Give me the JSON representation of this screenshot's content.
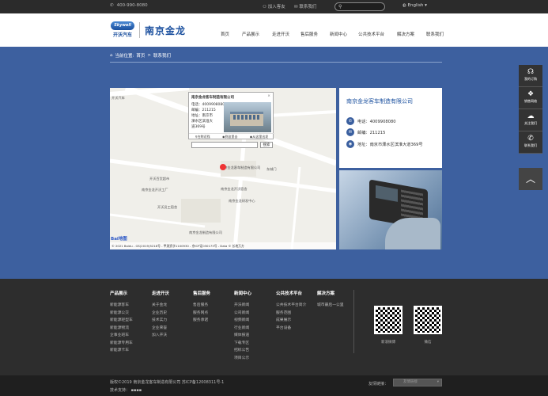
{
  "topbar": {
    "phone": "400-990-8080",
    "join": "加入客友",
    "contact": "联系我们",
    "language": "English"
  },
  "header": {
    "logo_badge": "Skywell",
    "logo_sub": "开沃汽车",
    "logo_cn": "南京金龙"
  },
  "nav": {
    "items": [
      "首页",
      "产品展示",
      "走进开沃",
      "售后服务",
      "新闻中心",
      "公共技术平台",
      "解决方案",
      "联系我们"
    ]
  },
  "breadcrumb": {
    "prefix": "当前位置:",
    "home": "首页",
    "sep": ">",
    "current": "联系我们"
  },
  "map": {
    "info_title": "南京金龙客车制造有限公司",
    "phone": "电话：4009908080",
    "post": "邮编：211215",
    "address": "地址：南京市溧水区滨淮大道369号",
    "act_route": "在附近找",
    "act_to": "到这里去",
    "act_from": "从这里出发",
    "search_btn": "搜索",
    "labels": [
      "开沃汽车",
      "开沃百货超市",
      "开沃员工宿舍",
      "南京金龙开沃宿舍",
      "东城门",
      "南京金龙开沃工厂",
      "南京金龙制造有限公司",
      "南京金龙客车制造有限公司",
      "南京金龙研发中心"
    ],
    "logo": "Bai地图",
    "copyright": "© 2021 Baidu - GS(2019)5218号 - 甲测资字1100930 - 京ICP证030173号 - Data © 长地万方"
  },
  "card": {
    "name": "南京金龙客车制造有限公司",
    "phone": "电话：4009908080",
    "post": "邮编：211215",
    "address": "地址：南京市溧水区滨淮大道369号"
  },
  "side": {
    "items": [
      "我的订购",
      "销售网络",
      "关注我们",
      "联系我们"
    ]
  },
  "footer": {
    "columns": [
      {
        "title": "产品展示",
        "items": [
          "新能源客车",
          "新能源公交",
          "新能源轻型车",
          "新能源物流",
          "企事业班车",
          "新能源专用车",
          "新能源卡车"
        ]
      },
      {
        "title": "走进开沃",
        "items": [
          "关于金龙",
          "企业历史",
          "技术实力",
          "企业荣誉",
          "加入开沃"
        ]
      },
      {
        "title": "售后服务",
        "items": [
          "售后服务",
          "服务网点",
          "服务承诺"
        ]
      },
      {
        "title": "新闻中心",
        "items": [
          "开沃新闻",
          "公司新闻",
          "视频新闻",
          "行业新闻",
          "媒体报道",
          "下载专区",
          "招标公告",
          "项目公示"
        ]
      },
      {
        "title": "公共技术平台",
        "items": [
          "公共技术平台简介",
          "服务范围",
          "成果展示",
          "平台设备"
        ]
      },
      {
        "title": "解决方案",
        "items": [
          "城市最后一公里"
        ]
      }
    ],
    "qr_labels": [
      "新浪微博",
      "微信"
    ]
  },
  "bottom": {
    "copyright": "版权©2019 南京金龙客车制造有限公司 苏ICP备12008311号-1",
    "tech": "技术支持：",
    "friend_links": "友情链接：",
    "select": "友情链接"
  }
}
